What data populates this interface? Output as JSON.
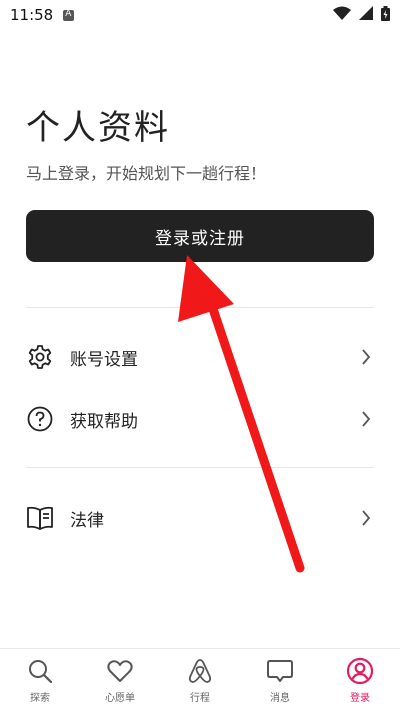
{
  "status_bar": {
    "time": "11:58"
  },
  "profile": {
    "title": "个人资料",
    "subtitle": "马上登录，开始规划下一趟行程！",
    "login_button": "登录或注册"
  },
  "menu": [
    {
      "label": "账号设置",
      "icon": "gear-icon"
    },
    {
      "label": "获取帮助",
      "icon": "help-icon"
    },
    {
      "label": "法律",
      "icon": "book-icon"
    }
  ],
  "tabs": [
    {
      "label": "探索",
      "icon": "search-icon",
      "active": false
    },
    {
      "label": "心愿单",
      "icon": "heart-icon",
      "active": false
    },
    {
      "label": "行程",
      "icon": "airbnb-logo-icon",
      "active": false
    },
    {
      "label": "消息",
      "icon": "message-icon",
      "active": false
    },
    {
      "label": "登录",
      "icon": "profile-icon",
      "active": true
    }
  ],
  "colors": {
    "accent": "#E31C5F",
    "button_bg": "#222222",
    "annotation_arrow": "#F01818"
  }
}
